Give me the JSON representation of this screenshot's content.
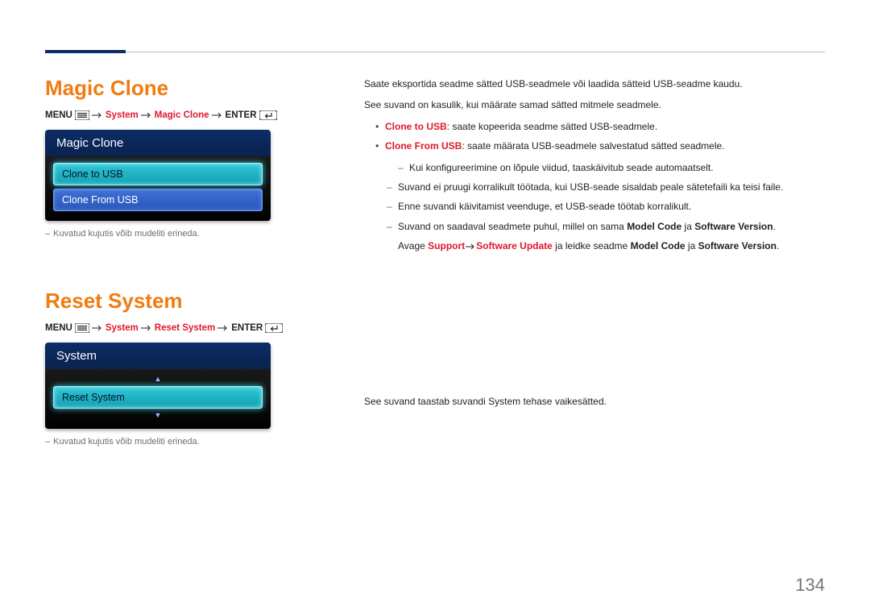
{
  "pageNumber": "134",
  "notes": {
    "imageNote": "Kuvatud kujutis võib mudeliti erineda."
  },
  "breadcrumbCommon": {
    "menuLabel": "MENU",
    "enterLabel": "ENTER"
  },
  "section1": {
    "title": "Magic Clone",
    "breadcrumbPath": {
      "a": "System",
      "b": "Magic Clone"
    },
    "osd": {
      "header": "Magic Clone",
      "item1": "Clone to USB",
      "item2": "Clone From USB"
    },
    "body": {
      "p1": "Saate eksportida seadme sätted USB-seadmele või laadida sätteid USB-seadme kaudu.",
      "p2": "See suvand on kasulik, kui määrate samad sätted mitmele seadmele.",
      "li1_red": "Clone to USB",
      "li1_rest": ": saate kopeerida seadme sätted USB-seadmele.",
      "li2_red": "Clone From USB",
      "li2_rest": ": saate määrata USB-seadmele salvestatud sätted seadmele.",
      "sub_a": "Kui konfigureerimine on lõpule viidud, taaskäivitub seade automaatselt.",
      "sub_b": "Suvand ei pruugi korralikult töötada, kui USB-seade sisaldab peale sätetefaili ka teisi faile.",
      "sub_c": "Enne suvandi käivitamist veenduge, et USB-seade töötab korralikult.",
      "sub_d_pre": "Suvand on saadaval seadmete puhul, millel on sama ",
      "sub_d_b1": "Model Code",
      "sub_d_mid": " ja ",
      "sub_d_b2": "Software Version",
      "sub_d_post": ".",
      "sub2_pre": "Avage ",
      "sub2_r1": "Support",
      "sub2_arrow": " → ",
      "sub2_r2": "Software Update",
      "sub2_mid1": " ja leidke seadme ",
      "sub2_b1": "Model Code",
      "sub2_mid2": " ja ",
      "sub2_b2": "Software Version",
      "sub2_post": "."
    }
  },
  "section2": {
    "title": "Reset System",
    "breadcrumbPath": {
      "a": "System",
      "b": "Reset System"
    },
    "osd": {
      "header": "System",
      "item1": "Reset System"
    },
    "body": {
      "p1": "See suvand taastab suvandi System tehase vaikesätted."
    }
  }
}
